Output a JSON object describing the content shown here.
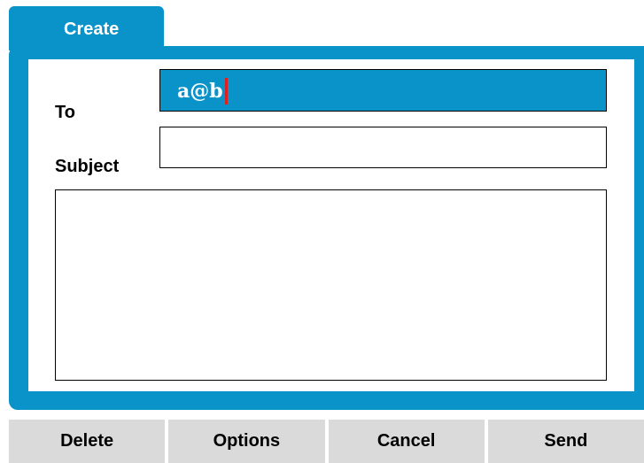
{
  "colors": {
    "accent": "#0a93c9",
    "caret": "#e0201e"
  },
  "tab": {
    "label": "Create"
  },
  "form": {
    "to_label": "To",
    "to_value": "a@b",
    "subject_label": "Subject",
    "subject_value": "",
    "body_value": ""
  },
  "softkeys": [
    {
      "label": "Delete"
    },
    {
      "label": "Options"
    },
    {
      "label": "Cancel"
    },
    {
      "label": "Send"
    }
  ]
}
